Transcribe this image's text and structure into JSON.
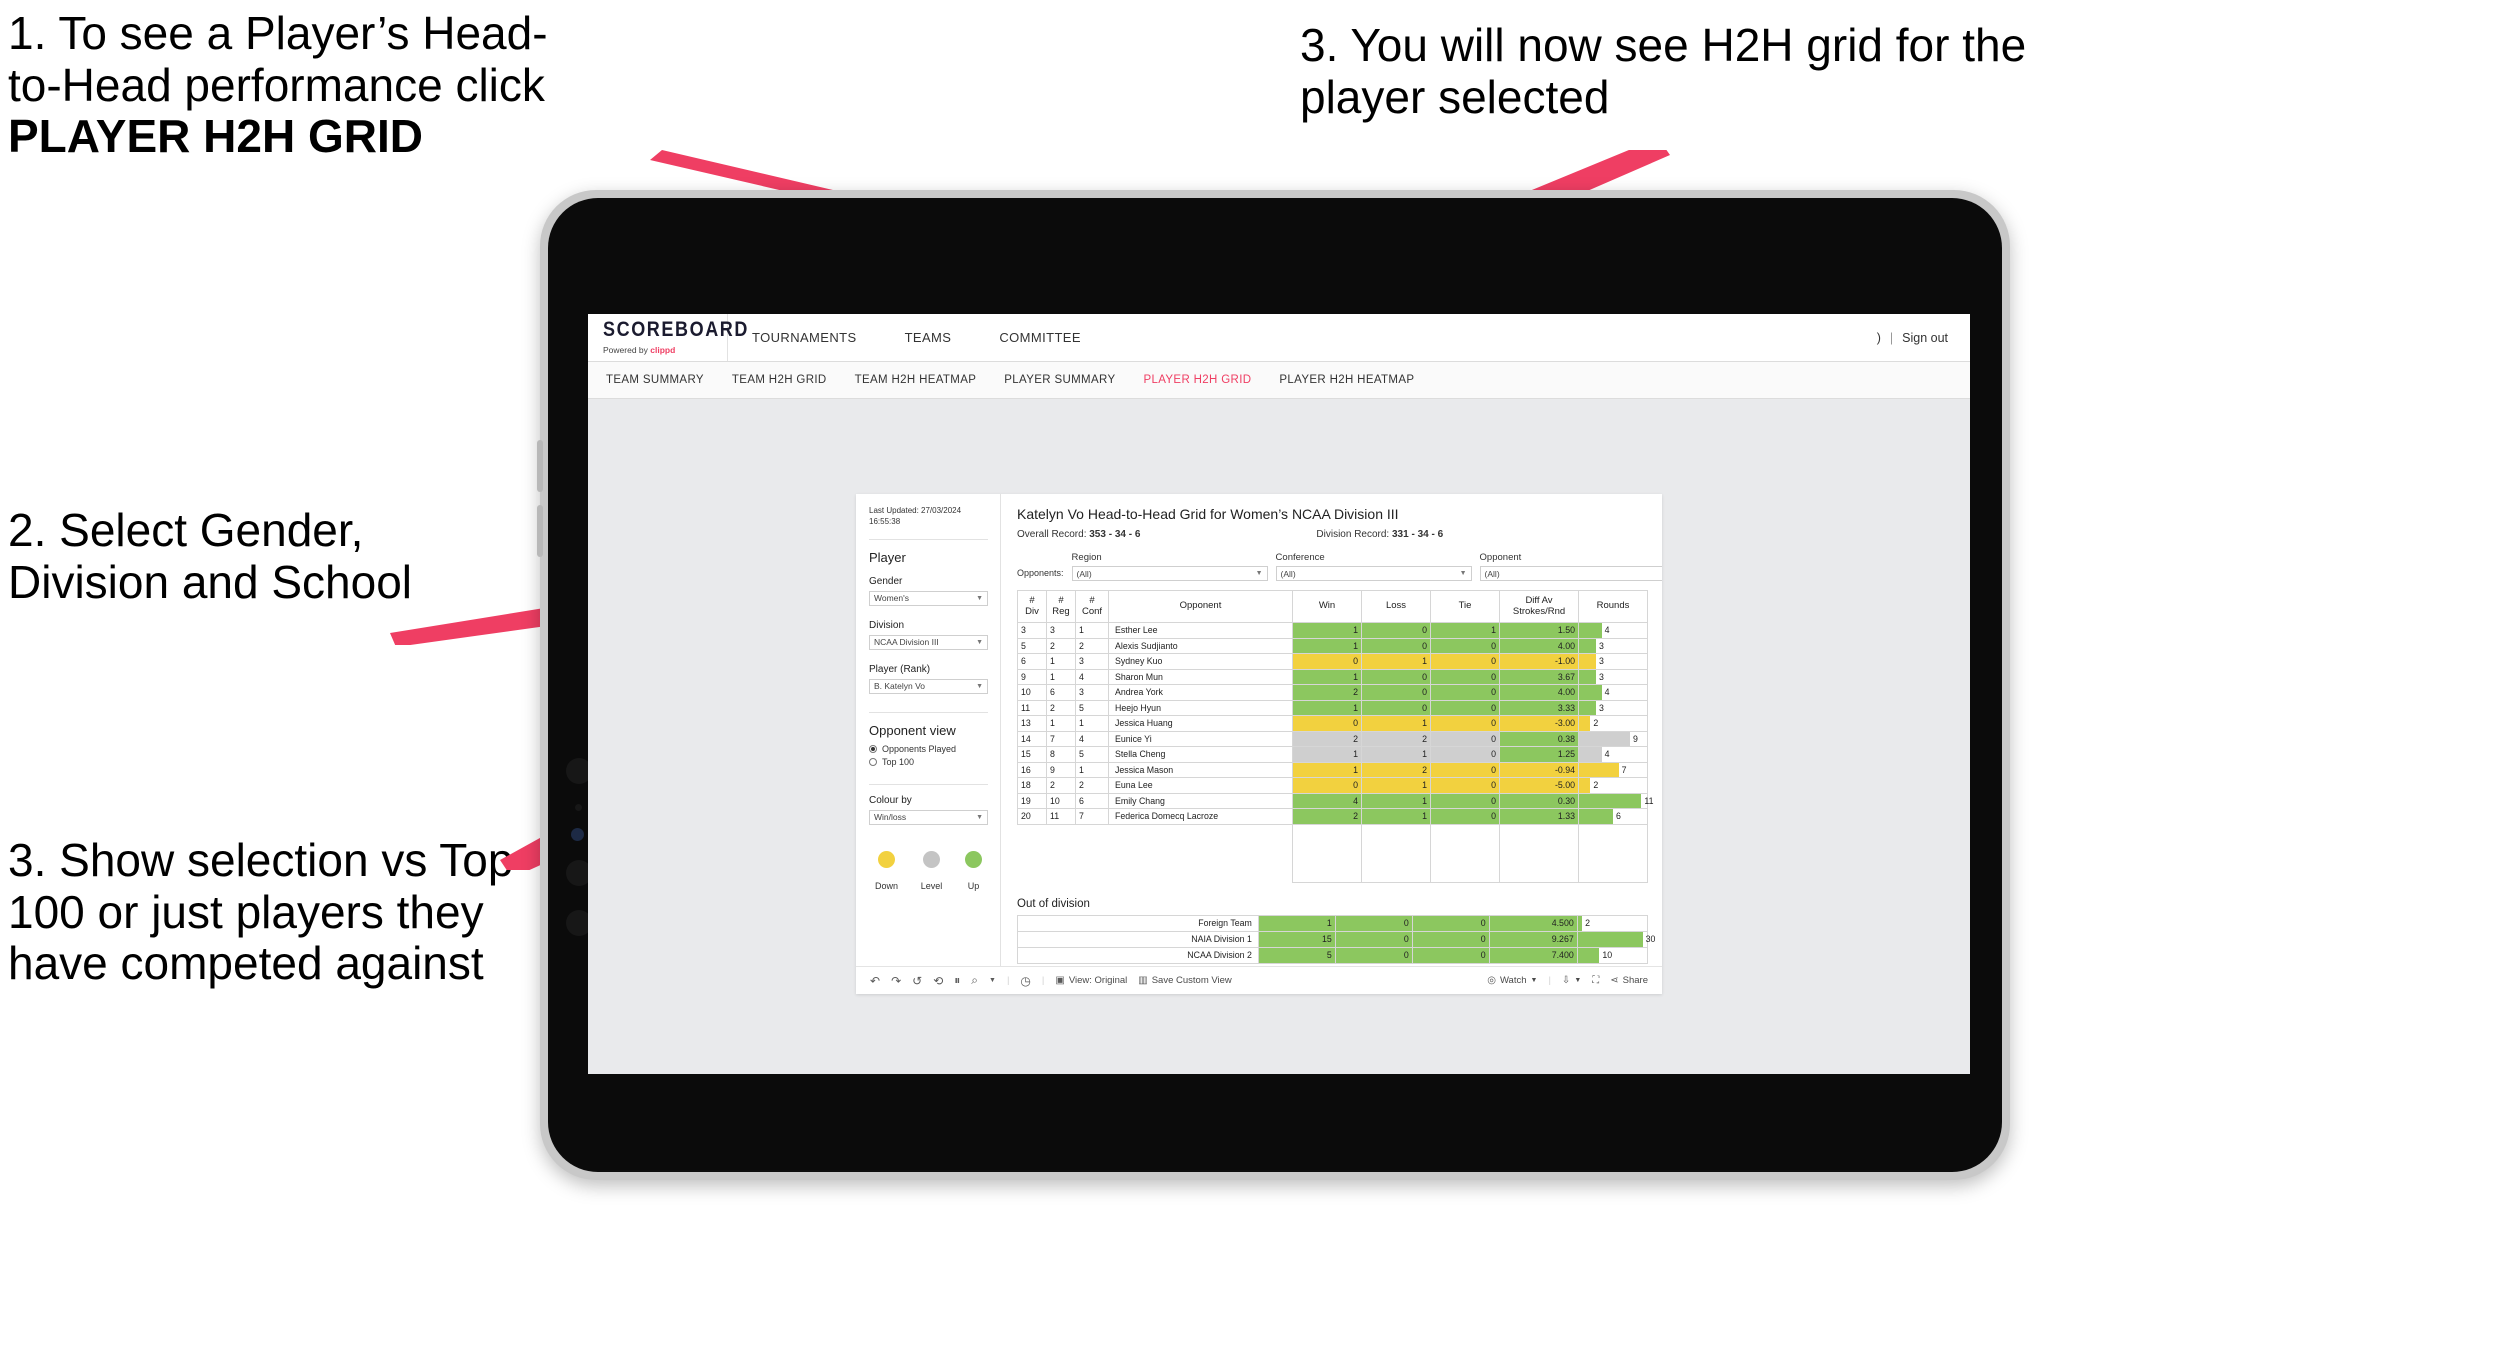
{
  "annotations": {
    "a1_line1": "1. To see a Player’s Head-",
    "a1_line2": "to-Head performance click ",
    "a1_bold": "PLAYER H2H GRID",
    "a2": "2. Select Gender, Division and School",
    "a3": "3. Show selection vs Top 100 or just players they have competed against",
    "a4": "3. You will now see H2H grid for the player selected",
    "accent_color": "#ef3e63"
  },
  "topnav": {
    "brand_word": "SCOREBOARD",
    "brand_powered": "Powered by ",
    "brand_clippd": "clippd",
    "items": [
      {
        "label": "TOURNAMENTS"
      },
      {
        "label": "TEAMS"
      },
      {
        "label": "COMMITTEE"
      }
    ],
    "right_user": ")",
    "separator": "|",
    "signout": "Sign out"
  },
  "subnav": {
    "items": [
      {
        "label": "TEAM SUMMARY",
        "active": false
      },
      {
        "label": "TEAM H2H GRID",
        "active": false
      },
      {
        "label": "TEAM H2H HEATMAP",
        "active": false
      },
      {
        "label": "PLAYER SUMMARY",
        "active": false
      },
      {
        "label": "PLAYER H2H GRID",
        "active": true
      },
      {
        "label": "PLAYER H2H HEATMAP",
        "active": false
      }
    ]
  },
  "sidebar": {
    "last_updated_line1": "Last Updated: 27/03/2024",
    "last_updated_line2": "16:55:38",
    "player_heading": "Player",
    "gender_label": "Gender",
    "gender_value": "Women's",
    "division_label": "Division",
    "division_value": "NCAA Division III",
    "player_rank_label": "Player (Rank)",
    "player_rank_value": "B. Katelyn Vo",
    "opponent_view_heading": "Opponent view",
    "opt_opponents_played": "Opponents Played",
    "opt_top100": "Top 100",
    "colour_by_label": "Colour by",
    "colour_by_value": "Win/loss",
    "legend": [
      {
        "label": "Down",
        "color": "#f2d13f"
      },
      {
        "label": "Level",
        "color": "#c4c4c4"
      },
      {
        "label": "Up",
        "color": "#8cc75f"
      }
    ]
  },
  "main": {
    "title": "Katelyn Vo Head-to-Head Grid for Women’s NCAA Division III",
    "overall_label": "Overall Record:",
    "overall_value": "353 - 34 - 6",
    "division_label": "Division Record:",
    "division_value": "331 - 34 - 6",
    "opponents_label": "Opponents:",
    "filters": [
      {
        "title": "Region",
        "value": "(All)"
      },
      {
        "title": "Conference",
        "value": "(All)"
      },
      {
        "title": "Opponent",
        "value": "(All)"
      }
    ],
    "out_of_division_title": "Out of division"
  },
  "chart_data": {
    "type": "table",
    "title": "Katelyn Vo Head-to-Head Grid for Women’s NCAA Division III",
    "columns": [
      "# Div",
      "# Reg",
      "# Conf",
      "Opponent",
      "Win",
      "Loss",
      "Tie",
      "Diff Av Strokes/Rnd",
      "Rounds"
    ],
    "column_headers_multiline": [
      [
        "#",
        "Div"
      ],
      [
        "#",
        "Reg"
      ],
      [
        "#",
        "Conf"
      ],
      [
        "Opponent"
      ],
      [
        "Win"
      ],
      [
        "Loss"
      ],
      [
        "Tie"
      ],
      [
        "Diff Av",
        "Strokes/Rnd"
      ],
      [
        "Rounds"
      ]
    ],
    "rounds_max": 12,
    "rows": [
      {
        "div": "3",
        "reg": "3",
        "conf": "1",
        "opponent": "Esther Lee",
        "win": "1",
        "loss": "0",
        "tie": "1",
        "diff": "1.50",
        "rounds": 4,
        "state": "up"
      },
      {
        "div": "5",
        "reg": "2",
        "conf": "2",
        "opponent": "Alexis Sudjianto",
        "win": "1",
        "loss": "0",
        "tie": "0",
        "diff": "4.00",
        "rounds": 3,
        "state": "up"
      },
      {
        "div": "6",
        "reg": "1",
        "conf": "3",
        "opponent": "Sydney Kuo",
        "win": "0",
        "loss": "1",
        "tie": "0",
        "diff": "-1.00",
        "rounds": 3,
        "state": "down"
      },
      {
        "div": "9",
        "reg": "1",
        "conf": "4",
        "opponent": "Sharon Mun",
        "win": "1",
        "loss": "0",
        "tie": "0",
        "diff": "3.67",
        "rounds": 3,
        "state": "up"
      },
      {
        "div": "10",
        "reg": "6",
        "conf": "3",
        "opponent": "Andrea York",
        "win": "2",
        "loss": "0",
        "tie": "0",
        "diff": "4.00",
        "rounds": 4,
        "state": "up"
      },
      {
        "div": "11",
        "reg": "2",
        "conf": "5",
        "opponent": "Heejo Hyun",
        "win": "1",
        "loss": "0",
        "tie": "0",
        "diff": "3.33",
        "rounds": 3,
        "state": "up"
      },
      {
        "div": "13",
        "reg": "1",
        "conf": "1",
        "opponent": "Jessica Huang",
        "win": "0",
        "loss": "1",
        "tie": "0",
        "diff": "-3.00",
        "rounds": 2,
        "state": "down"
      },
      {
        "div": "14",
        "reg": "7",
        "conf": "4",
        "opponent": "Eunice Yi",
        "win": "2",
        "loss": "2",
        "tie": "0",
        "diff": "0.38",
        "rounds": 9,
        "state": "level",
        "diff_state": "up"
      },
      {
        "div": "15",
        "reg": "8",
        "conf": "5",
        "opponent": "Stella Cheng",
        "win": "1",
        "loss": "1",
        "tie": "0",
        "diff": "1.25",
        "rounds": 4,
        "state": "level",
        "diff_state": "up"
      },
      {
        "div": "16",
        "reg": "9",
        "conf": "1",
        "opponent": "Jessica Mason",
        "win": "1",
        "loss": "2",
        "tie": "0",
        "diff": "-0.94",
        "rounds": 7,
        "state": "down"
      },
      {
        "div": "18",
        "reg": "2",
        "conf": "2",
        "opponent": "Euna Lee",
        "win": "0",
        "loss": "1",
        "tie": "0",
        "diff": "-5.00",
        "rounds": 2,
        "state": "down"
      },
      {
        "div": "19",
        "reg": "10",
        "conf": "6",
        "opponent": "Emily Chang",
        "win": "4",
        "loss": "1",
        "tie": "0",
        "diff": "0.30",
        "rounds": 11,
        "state": "up"
      },
      {
        "div": "20",
        "reg": "11",
        "conf": "7",
        "opponent": "Federica Domecq Lacroze",
        "win": "2",
        "loss": "1",
        "tie": "0",
        "diff": "1.33",
        "rounds": 6,
        "state": "up"
      }
    ],
    "out_of_division": {
      "rounds_max": 32,
      "rows": [
        {
          "name": "Foreign Team",
          "win": "1",
          "loss": "0",
          "tie": "0",
          "diff": "4.500",
          "rounds": 2,
          "state": "up"
        },
        {
          "name": "NAIA Division 1",
          "win": "15",
          "loss": "0",
          "tie": "0",
          "diff": "9.267",
          "rounds": 30,
          "state": "up"
        },
        {
          "name": "NCAA Division 2",
          "win": "5",
          "loss": "0",
          "tie": "0",
          "diff": "7.400",
          "rounds": 10,
          "state": "up"
        }
      ]
    },
    "colors": {
      "up": "#8cc75f",
      "down": "#f2d13f",
      "level": "#cfcfcf",
      "neutral": "#ffffff"
    }
  },
  "toolbar": {
    "view_label": "View: Original",
    "save_label": "Save Custom View",
    "watch_label": "Watch",
    "share_label": "Share"
  }
}
